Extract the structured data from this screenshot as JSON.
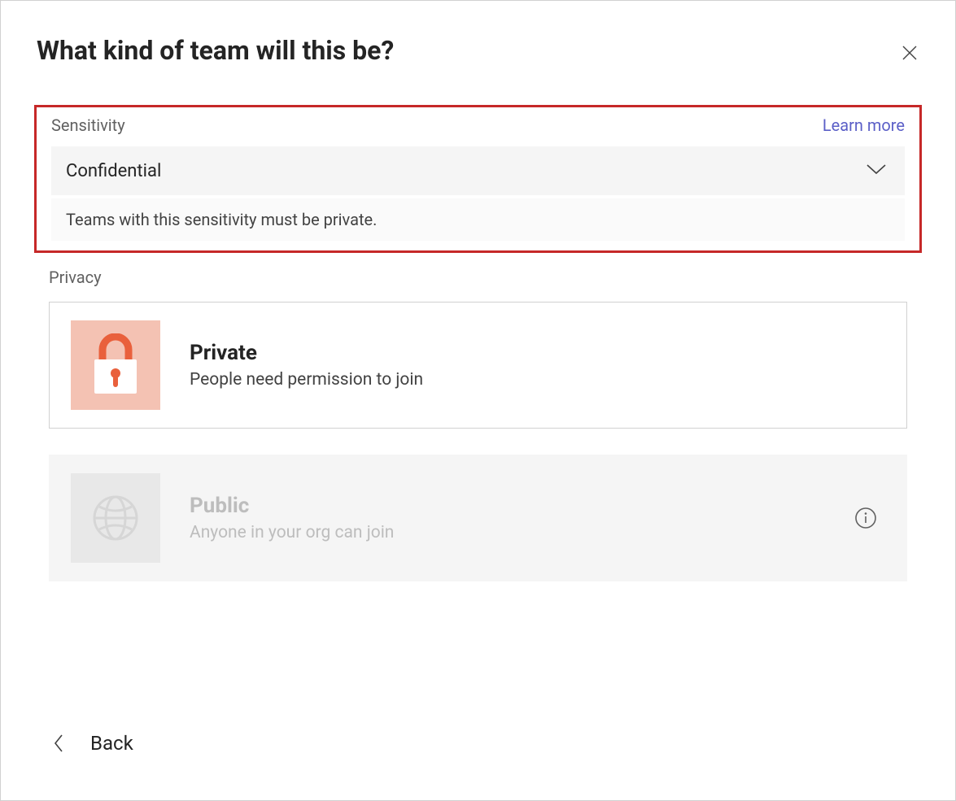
{
  "dialog": {
    "title": "What kind of team will this be?"
  },
  "sensitivity": {
    "label": "Sensitivity",
    "learn_more": "Learn more",
    "selected": "Confidential",
    "helper": "Teams with this sensitivity must be private."
  },
  "privacy": {
    "label": "Privacy",
    "options": [
      {
        "title": "Private",
        "description": "People need permission to join",
        "enabled": true
      },
      {
        "title": "Public",
        "description": "Anyone in your org can join",
        "enabled": false
      }
    ]
  },
  "footer": {
    "back": "Back"
  }
}
